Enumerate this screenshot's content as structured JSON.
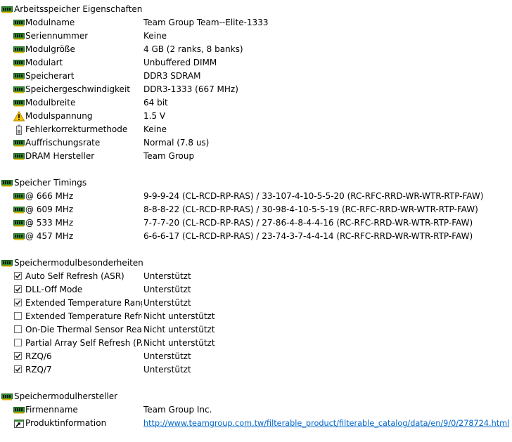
{
  "groups": [
    {
      "title": "Arbeitsspeicher Eigenschaften",
      "icon": "memory-module-icon",
      "rows": [
        {
          "label": "Modulname",
          "value": "Team Group Team--Elite-1333",
          "icon": "memory-module-icon"
        },
        {
          "label": "Seriennummer",
          "value": "Keine",
          "icon": "memory-module-icon"
        },
        {
          "label": "Modulgröße",
          "value": "4 GB (2 ranks, 8 banks)",
          "icon": "memory-module-icon"
        },
        {
          "label": "Modulart",
          "value": "Unbuffered DIMM",
          "icon": "memory-module-icon"
        },
        {
          "label": "Speicherart",
          "value": "DDR3 SDRAM",
          "icon": "memory-module-icon"
        },
        {
          "label": "Speichergeschwindigkeit",
          "value": "DDR3-1333 (667 MHz)",
          "icon": "memory-module-icon"
        },
        {
          "label": "Modulbreite",
          "value": "64 bit",
          "icon": "memory-module-icon"
        },
        {
          "label": "Modulspannung",
          "value": "1.5 V",
          "icon": "warning-icon"
        },
        {
          "label": "Fehlerkorrekturmethode",
          "value": "Keine",
          "icon": "battery-icon"
        },
        {
          "label": "Auffrischungsrate",
          "value": "Normal (7.8 us)",
          "icon": "memory-module-icon"
        },
        {
          "label": "DRAM Hersteller",
          "value": "Team Group",
          "icon": "memory-module-icon"
        }
      ]
    },
    {
      "title": "Speicher Timings",
      "icon": "memory-module-icon",
      "rows": [
        {
          "label": "@ 666 MHz",
          "value": "9-9-9-24  (CL-RCD-RP-RAS) / 33-107-4-10-5-5-20  (RC-RFC-RRD-WR-WTR-RTP-FAW)",
          "icon": "memory-module-icon"
        },
        {
          "label": "@ 609 MHz",
          "value": "8-8-8-22  (CL-RCD-RP-RAS) / 30-98-4-10-5-5-19  (RC-RFC-RRD-WR-WTR-RTP-FAW)",
          "icon": "memory-module-icon"
        },
        {
          "label": "@ 533 MHz",
          "value": "7-7-7-20  (CL-RCD-RP-RAS) / 27-86-4-8-4-4-16  (RC-RFC-RRD-WR-WTR-RTP-FAW)",
          "icon": "memory-module-icon"
        },
        {
          "label": "@ 457 MHz",
          "value": "6-6-6-17  (CL-RCD-RP-RAS) / 23-74-3-7-4-4-14  (RC-RFC-RRD-WR-WTR-RTP-FAW)",
          "icon": "memory-module-icon"
        }
      ]
    },
    {
      "title": "Speichermodulbesonderheiten",
      "icon": "memory-module-icon",
      "rows": [
        {
          "label": "Auto Self Refresh (ASR)",
          "value": "Unterstützt",
          "checked": true
        },
        {
          "label": "DLL-Off Mode",
          "value": "Unterstützt",
          "checked": true
        },
        {
          "label": "Extended Temperature Range",
          "value": "Unterstützt",
          "checked": true
        },
        {
          "label": "Extended Temperature Refre...",
          "value": "Nicht unterstützt",
          "checked": false
        },
        {
          "label": "On-Die Thermal Sensor Rea...",
          "value": "Nicht unterstützt",
          "checked": false
        },
        {
          "label": "Partial Array Self Refresh (PA...",
          "value": "Nicht unterstützt",
          "checked": false
        },
        {
          "label": "RZQ/6",
          "value": "Unterstützt",
          "checked": true
        },
        {
          "label": "RZQ/7",
          "value": "Unterstützt",
          "checked": true
        }
      ]
    },
    {
      "title": "Speichermodulhersteller",
      "icon": "memory-module-icon",
      "rows": [
        {
          "label": "Firmenname",
          "value": "Team Group Inc.",
          "icon": "memory-module-icon"
        },
        {
          "label": "Produktinformation",
          "value": "http://www.teamgroup.com.tw/filterable_product/filterable_catalog/data/en/9/0/278724.html",
          "icon": "link-icon",
          "link": true
        }
      ]
    }
  ],
  "colors": {
    "link": "#0066cc",
    "module_green": "#2f8f2f",
    "warning_yellow": "#f5c400"
  }
}
